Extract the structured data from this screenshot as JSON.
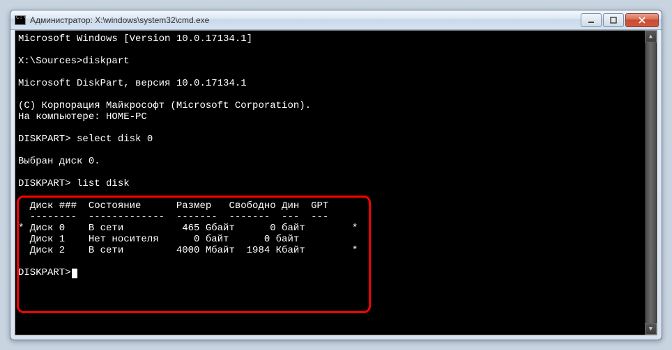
{
  "window": {
    "title": "Администратор: X:\\windows\\system32\\cmd.exe",
    "icon_glyph": "C:\\."
  },
  "terminal": {
    "lines": [
      "Microsoft Windows [Version 10.0.17134.1]",
      "",
      "X:\\Sources>diskpart",
      "",
      "Microsoft DiskPart, версия 10.0.17134.1",
      "",
      "(C) Корпорация Майкрософт (Microsoft Corporation).",
      "На компьютере: HOME-PC",
      "",
      "DISKPART> select disk 0",
      "",
      "Выбран диск 0.",
      "",
      "DISKPART> list disk",
      "",
      "  Диск ###  Состояние      Размер   Свободно Дин  GPT",
      "  --------  -------------  -------  -------  ---  ---",
      "* Диск 0    В сети          465 Gбайт      0 байт        *",
      "  Диск 1    Нет носителя      0 байт      0 байт",
      "  Диск 2    В сети         4000 Мбайт  1984 Кбайт        *",
      "",
      "DISKPART>"
    ]
  },
  "disk_table": {
    "headers": [
      "Диск ###",
      "Состояние",
      "Размер",
      "Свободно",
      "Дин",
      "GPT"
    ],
    "rows": [
      {
        "selected": "*",
        "id": "Диск 0",
        "status": "В сети",
        "size": "465 Gбайт",
        "free": "0 байт",
        "dyn": "",
        "gpt": "*"
      },
      {
        "selected": "",
        "id": "Диск 1",
        "status": "Нет носителя",
        "size": "0 байт",
        "free": "0 байт",
        "dyn": "",
        "gpt": ""
      },
      {
        "selected": "",
        "id": "Диск 2",
        "status": "В сети",
        "size": "4000 Мбайт",
        "free": "1984 Кбайт",
        "dyn": "",
        "gpt": "*"
      }
    ]
  }
}
